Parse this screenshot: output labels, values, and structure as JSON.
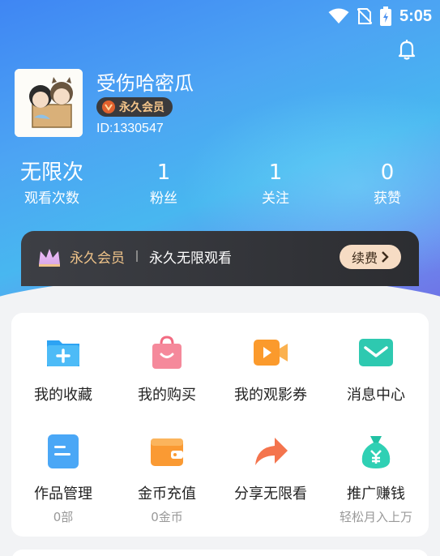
{
  "status_bar": {
    "time": "5:05"
  },
  "profile": {
    "username": "受伤哈密瓜",
    "vip_badge": "永久会员",
    "user_id": "ID:1330547"
  },
  "stats": [
    {
      "value": "无限次",
      "label": "观看次数"
    },
    {
      "value": "1",
      "label": "粉丝"
    },
    {
      "value": "1",
      "label": "关注"
    },
    {
      "value": "0",
      "label": "获赞"
    }
  ],
  "vip_bar": {
    "title": "永久会员",
    "desc": "永久无限观看",
    "renew_label": "续费"
  },
  "menu": {
    "items": [
      {
        "label": "我的收藏",
        "icon": "folder-plus-icon",
        "sub": ""
      },
      {
        "label": "我的购买",
        "icon": "shopping-bag-icon",
        "sub": ""
      },
      {
        "label": "我的观影券",
        "icon": "video-ticket-icon",
        "sub": ""
      },
      {
        "label": "消息中心",
        "icon": "mail-icon",
        "sub": ""
      },
      {
        "label": "作品管理",
        "icon": "document-icon",
        "sub": "0部"
      },
      {
        "label": "金币充值",
        "icon": "wallet-icon",
        "sub": "0金币"
      },
      {
        "label": "分享无限看",
        "icon": "share-arrow-icon",
        "sub": ""
      },
      {
        "label": "推广赚钱",
        "icon": "money-bag-icon",
        "sub": "轻松月入上万"
      }
    ]
  },
  "colors": {
    "hero_gradient_start": "#3f86f3",
    "hero_gradient_end": "#6f74e6",
    "vip_gold": "#f0c48a",
    "renew_bg": "#f6dcc4"
  }
}
